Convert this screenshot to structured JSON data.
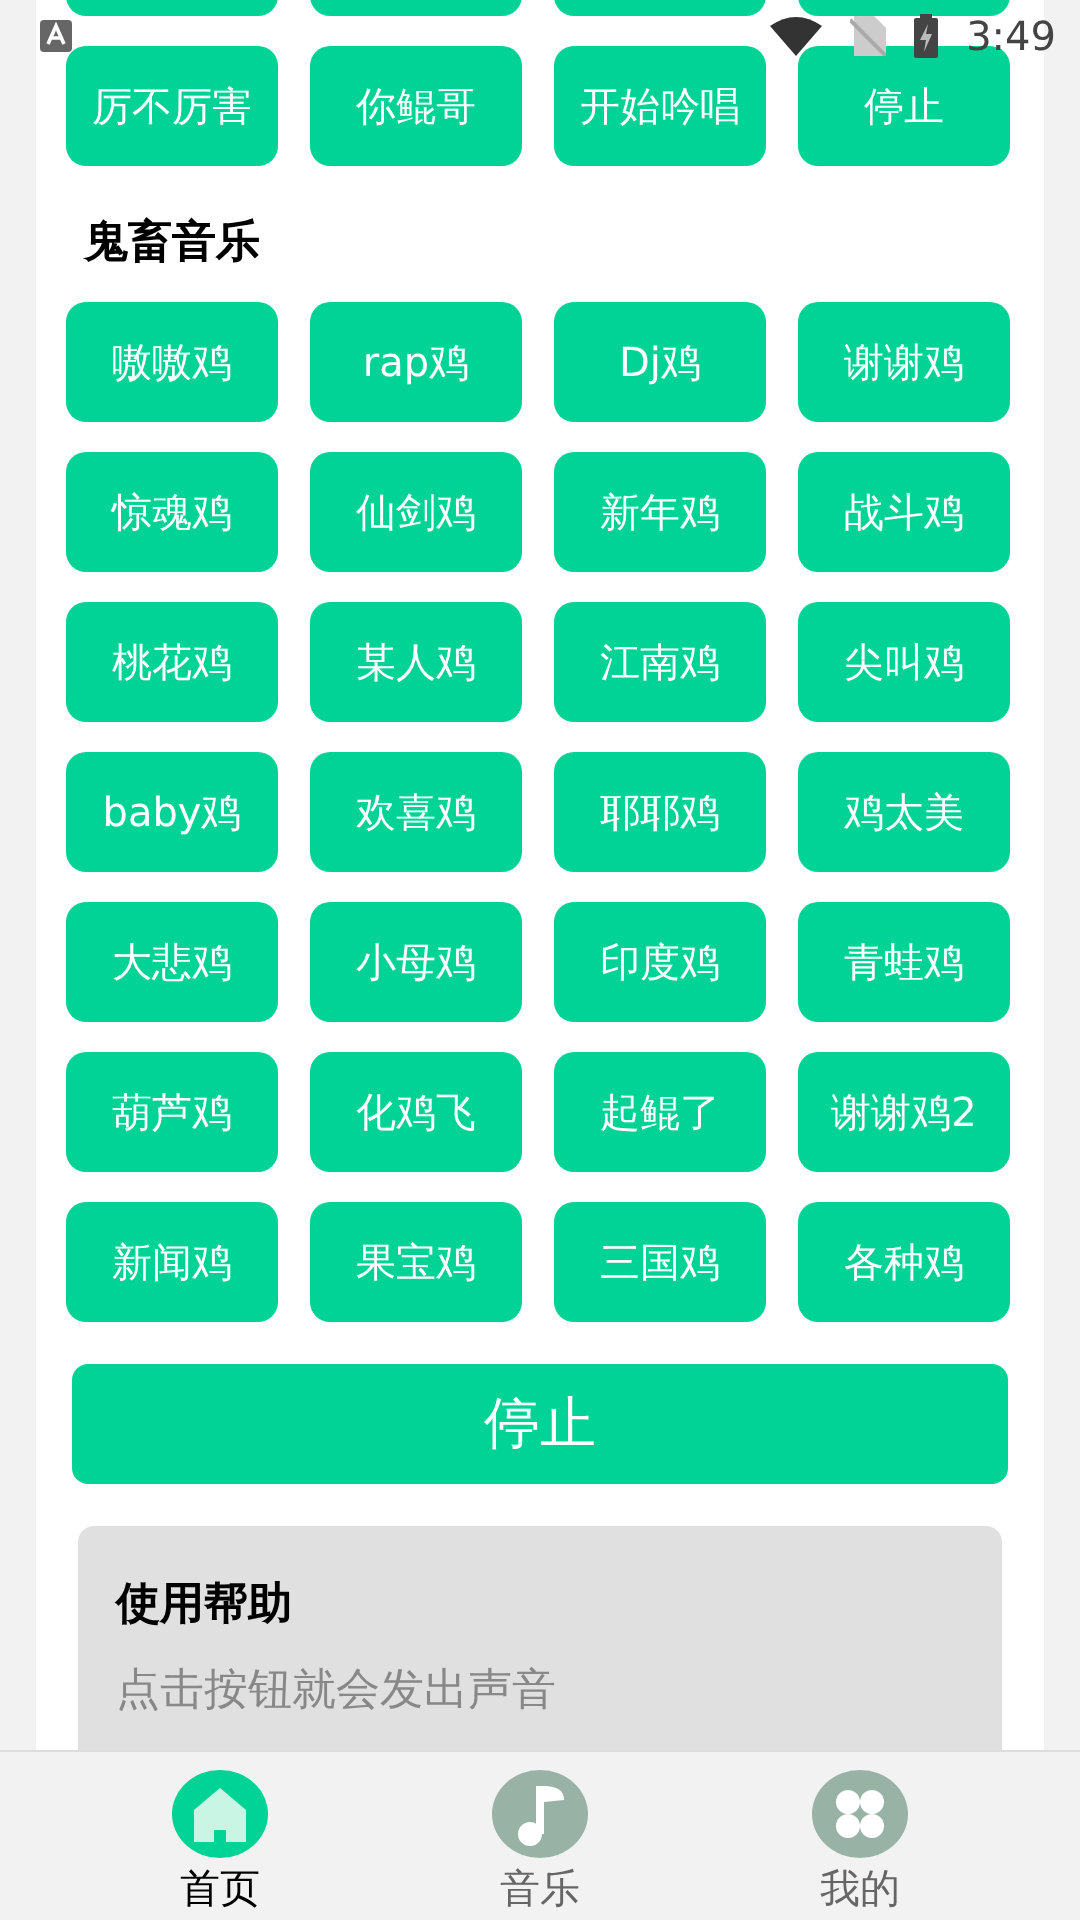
{
  "status_bar": {
    "time": "3:49"
  },
  "top_section": {
    "buttons": [
      {
        "kind": "cut"
      },
      {
        "kind": "cut"
      },
      {
        "kind": "cut"
      },
      {
        "kind": "cut"
      },
      {
        "kind": "label",
        "label": "厉不厉害"
      },
      {
        "kind": "label",
        "label": "你鲲哥"
      },
      {
        "kind": "label",
        "label": "开始吟唱"
      },
      {
        "kind": "label",
        "label": "停止"
      }
    ]
  },
  "guichu_section": {
    "title": "鬼畜音乐",
    "buttons": [
      "嗷嗷鸡",
      "rap鸡",
      "Dj鸡",
      "谢谢鸡",
      "惊魂鸡",
      "仙剑鸡",
      "新年鸡",
      "战斗鸡",
      "桃花鸡",
      "某人鸡",
      "江南鸡",
      "尖叫鸡",
      "baby鸡",
      "欢喜鸡",
      "耶耶鸡",
      "鸡太美",
      "大悲鸡",
      "小母鸡",
      "印度鸡",
      "青蛙鸡",
      "葫芦鸡",
      "化鸡飞",
      "起鲲了",
      "谢谢鸡2",
      "新闻鸡",
      "果宝鸡",
      "三国鸡",
      "各种鸡"
    ],
    "stop_button": "停止"
  },
  "help": {
    "title": "使用帮助",
    "text": "点击按钮就会发出声音"
  },
  "bottom_nav": [
    {
      "label": "首页",
      "selected": true
    },
    {
      "label": "音乐",
      "selected": false
    },
    {
      "label": "我的",
      "selected": false
    }
  ]
}
